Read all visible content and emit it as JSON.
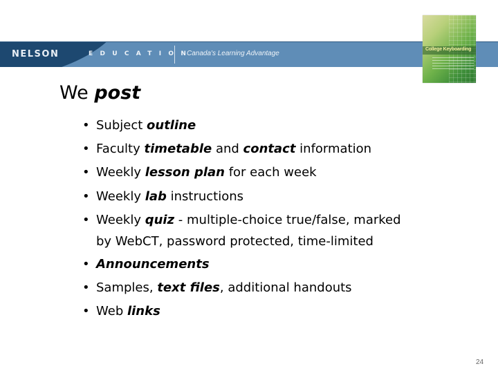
{
  "banner": {
    "brand": "NELSON",
    "division": "EDUCATION",
    "tagline": "Canada's Learning Advantage",
    "colors": {
      "dark": "#1d4870",
      "light": "#5f8db7"
    }
  },
  "book_cover": {
    "title": "College Keyboarding"
  },
  "slide": {
    "title_plain": "We ",
    "title_emphasis": "post",
    "bullets": [
      {
        "segments": [
          {
            "text": "Subject "
          },
          {
            "text": "outline",
            "em": true
          }
        ]
      },
      {
        "segments": [
          {
            "text": "Faculty "
          },
          {
            "text": "timetable",
            "em": true
          },
          {
            "text": " and "
          },
          {
            "text": "contact",
            "em": true
          },
          {
            "text": " information"
          }
        ]
      },
      {
        "segments": [
          {
            "text": "Weekly "
          },
          {
            "text": "lesson plan",
            "em": true
          },
          {
            "text": " for each week"
          }
        ]
      },
      {
        "segments": [
          {
            "text": "Weekly "
          },
          {
            "text": "lab",
            "em": true
          },
          {
            "text": " instructions"
          }
        ]
      },
      {
        "segments": [
          {
            "text": "Weekly "
          },
          {
            "text": "quiz",
            "em": true
          },
          {
            "text": " - multiple-choice true/false, marked by WebCT, password protected, time-limited"
          }
        ]
      },
      {
        "segments": [
          {
            "text": "Announcements",
            "em": true
          }
        ]
      },
      {
        "segments": [
          {
            "text": "Samples, "
          },
          {
            "text": "text files",
            "em": true
          },
          {
            "text": ", additional handouts"
          }
        ]
      },
      {
        "segments": [
          {
            "text": "Web "
          },
          {
            "text": "links",
            "em": true
          }
        ]
      }
    ],
    "page_number": "24"
  }
}
